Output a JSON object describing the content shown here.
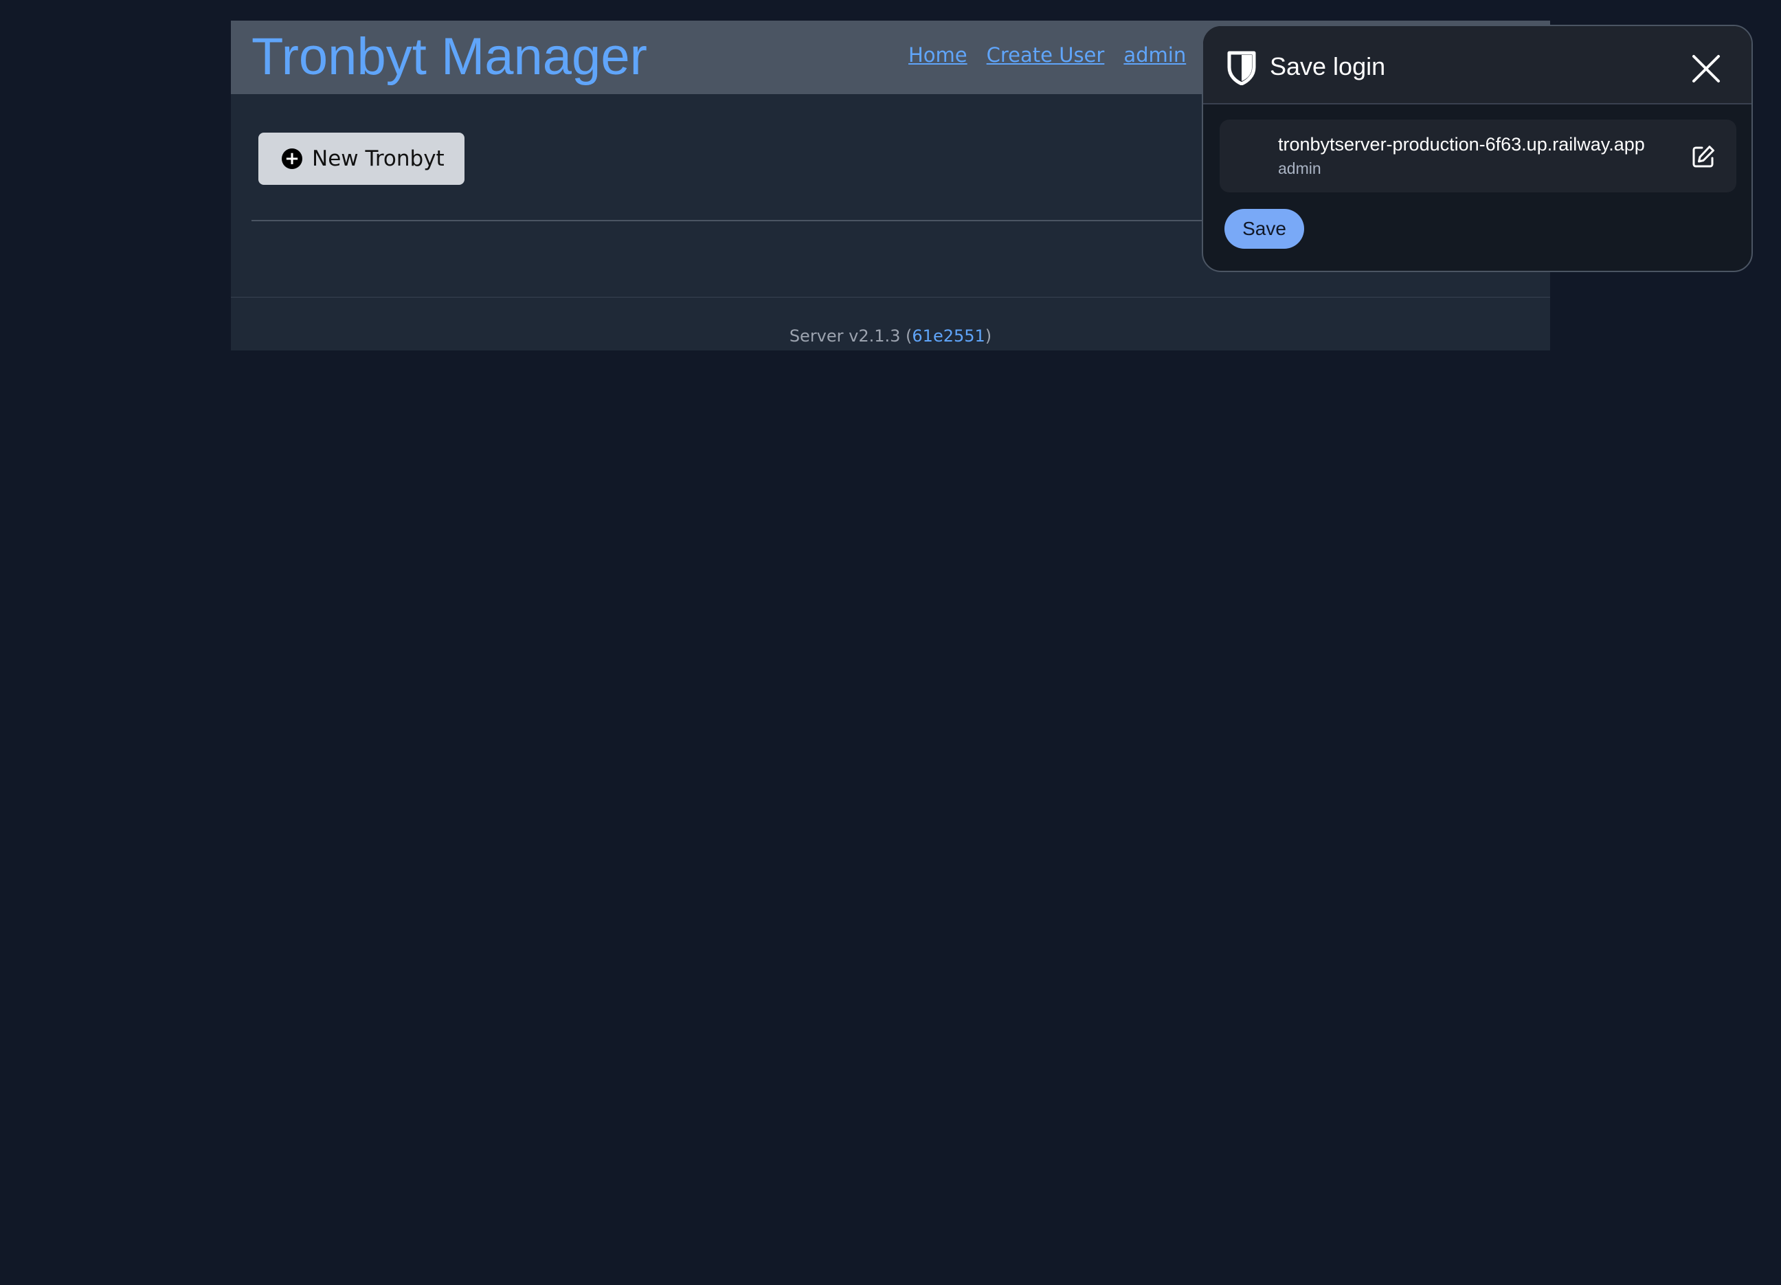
{
  "header": {
    "title": "Tronbyt Manager",
    "nav": {
      "home": "Home",
      "create_user": "Create User",
      "user": "admin"
    }
  },
  "main": {
    "new_button_label": "New Tronbyt",
    "new_button_icon": "plus-circle-icon"
  },
  "footer": {
    "prefix": "Server v2.1.3 (",
    "commit": "61e2551",
    "suffix": ")"
  },
  "popup": {
    "title": "Save login",
    "icon": "shield-icon",
    "close_icon": "close-icon",
    "login": {
      "site": "tronbytserver-production-6f63.up.railway.app",
      "username": "admin",
      "edit_icon": "edit-icon"
    },
    "save_label": "Save"
  },
  "colors": {
    "background": "#111827",
    "page": "#1f2937",
    "header": "#4b5563",
    "accent": "#60a5fa",
    "popup_background": "#131922",
    "save_button": "#79a9f7"
  }
}
